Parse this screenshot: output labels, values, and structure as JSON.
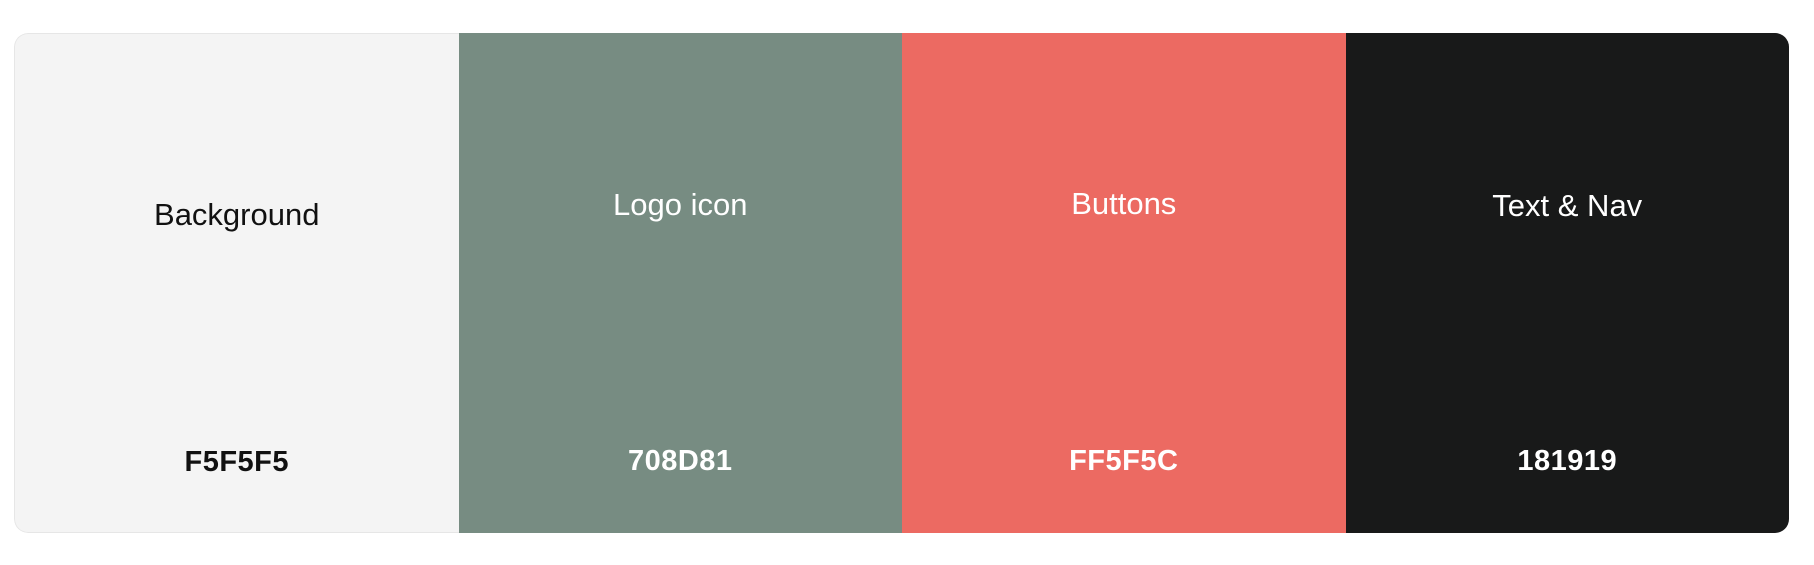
{
  "palette": {
    "swatches": [
      {
        "label": "Background",
        "hex_label": "F5F5F5",
        "color": "#F4F4F4",
        "text_color": "#111111"
      },
      {
        "label": "Logo icon",
        "hex_label": "708D81",
        "color": "#778C82",
        "text_color": "#FFFFFF"
      },
      {
        "label": "Buttons",
        "hex_label": "FF5F5C",
        "color": "#EC6A62",
        "text_color": "#FFFFFF"
      },
      {
        "label": "Text & Nav",
        "hex_label": "181919",
        "color": "#181919",
        "text_color": "#FFFFFF"
      }
    ]
  }
}
